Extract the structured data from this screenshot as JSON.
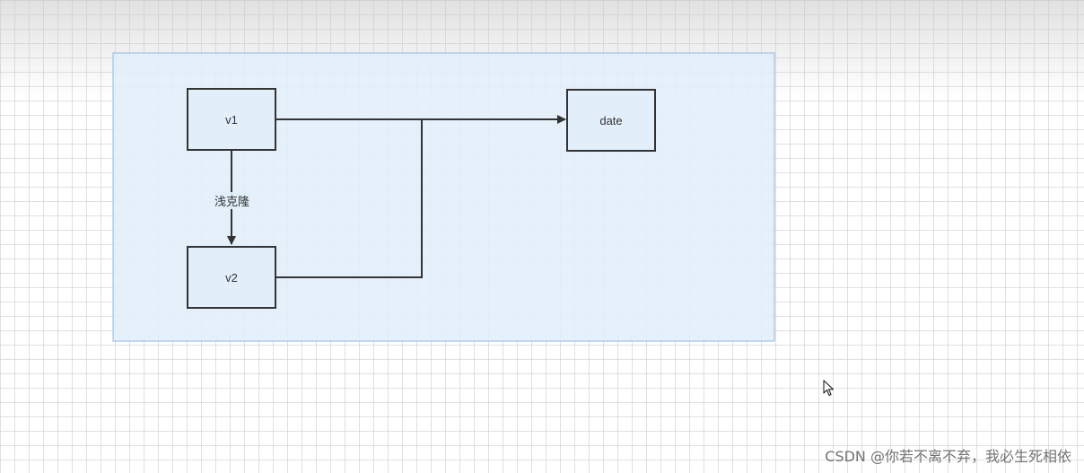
{
  "diagram": {
    "nodes": {
      "v1": {
        "label": "v1"
      },
      "v2": {
        "label": "v2"
      },
      "date": {
        "label": "date"
      }
    },
    "edges": {
      "v1_to_v2": {
        "label": "浅克隆"
      }
    }
  },
  "watermark": {
    "text": "CSDN @你若不离不弃，我必生死相依"
  },
  "colors": {
    "container_fill": "#e3eefb",
    "container_border": "#9fc1e6",
    "node_border": "#333333",
    "edge": "#333333"
  },
  "icons": {
    "cursor": "mouse-pointer-icon"
  }
}
